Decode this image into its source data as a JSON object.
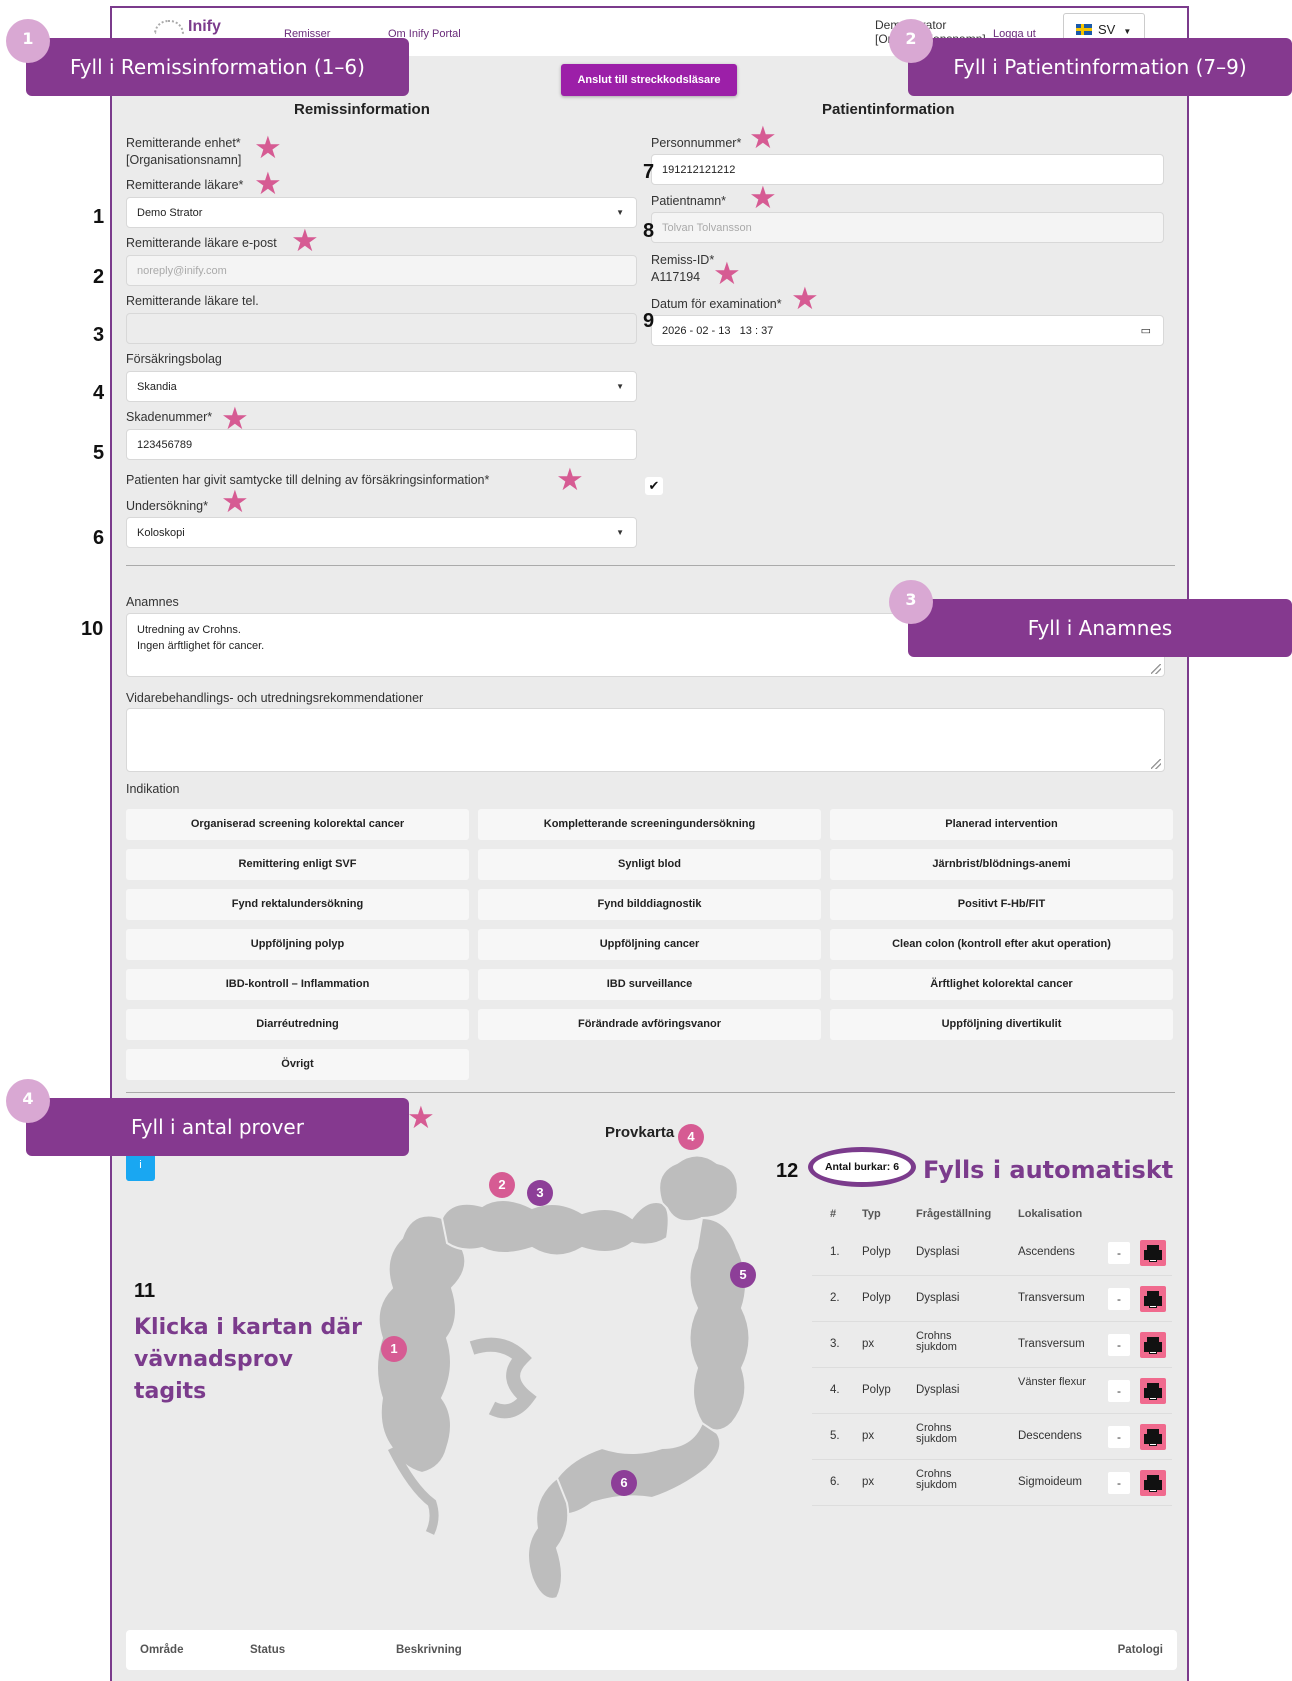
{
  "header": {
    "logo": "Inify",
    "nav": [
      "Remisser",
      "Om Inify Portal"
    ],
    "user_name": "Demo Strator",
    "user_org": "[Organisationsnamn]",
    "logout": "Logga ut",
    "language": "SV",
    "scan_button": "Anslut till streckkodsläsare"
  },
  "callouts": [
    {
      "n": "1",
      "text": "Fyll i Remissinformation (1–6)"
    },
    {
      "n": "2",
      "text": "Fyll i Patientinformation (7–9)"
    },
    {
      "n": "3",
      "text": "Fyll i Anamnes"
    },
    {
      "n": "4",
      "text": "Fyll i antal prover"
    }
  ],
  "remiss": {
    "title": "Remissinformation",
    "unit_label": "Remitterande enhet*",
    "unit_value": "[Organisationsnamn]",
    "doctor_label": "Remitterande läkare*",
    "doctor_value": "Demo Strator",
    "email_label": "Remitterande läkare e-post",
    "email_placeholder": "noreply@inify.com",
    "phone_label": "Remitterande läkare tel.",
    "phone_value": "",
    "insurer_label": "Försäkringsbolag",
    "insurer_value": "Skandia",
    "claim_label": "Skadenummer*",
    "claim_value": "123456789",
    "consent_label": "Patienten har givit samtycke till delning av försäkringsinformation*",
    "consent_checked": true,
    "exam_label": "Undersökning*",
    "exam_value": "Koloskopi"
  },
  "patient": {
    "title": "Patientinformation",
    "pnr_label": "Personnummer*",
    "pnr_value": "191212121212",
    "name_label": "Patientnamn*",
    "name_value": "Tolvan Tolvansson",
    "remiss_id_label": "Remiss-ID*",
    "remiss_id_value": "A117194",
    "date_label": "Datum för examination*",
    "date_value": "2026 - 02 - 13   13 : 37"
  },
  "anamnes": {
    "label": "Anamnes",
    "value": "Utredning av Crohns.\nIngen ärftlighet för cancer.",
    "rec_label": "Vidarebehandlings- och utredningsrekommendationer",
    "rec_value": ""
  },
  "indikation": {
    "label": "Indikation",
    "items": [
      "Organiserad screening kolorektal cancer",
      "Kompletterande screeningundersökning",
      "Planerad intervention",
      "Remittering enligt SVF",
      "Synligt blod",
      "Järnbrist/blödnings-anemi",
      "Fynd rektalundersökning",
      "Fynd bilddiagnostik",
      "Positivt F-Hb/FIT",
      "Uppföljning polyp",
      "Uppföljning cancer",
      "Clean colon (kontroll efter akut operation)",
      "IBD-kontroll – Inflammation",
      "IBD surveillance",
      "Ärftlighet kolorektal cancer",
      "Diarréutredning",
      "Förändrade avföringsvanor",
      "Uppföljning divertikulit",
      "Övrigt"
    ]
  },
  "provkarta": {
    "title": "Provkarta",
    "info_button": "i",
    "annotation_11": "11",
    "click_hint": "Klicka i kartan där vävnadsprov tagits",
    "annotation_12": "12",
    "antal": "Antal burkar: 6",
    "auto_text": "Fylls i automatiskt",
    "markers": [
      "1",
      "2",
      "3",
      "4",
      "5",
      "6"
    ],
    "columns": [
      "#",
      "Typ",
      "Frågeställning",
      "Lokalisation"
    ],
    "rows": [
      {
        "n": "1.",
        "typ": "Polyp",
        "fraga": "Dysplasi",
        "lok": "Ascendens"
      },
      {
        "n": "2.",
        "typ": "Polyp",
        "fraga": "Dysplasi",
        "lok": "Transversum"
      },
      {
        "n": "3.",
        "typ": "px",
        "fraga": "Crohns sjukdom",
        "lok": "Transversum"
      },
      {
        "n": "4.",
        "typ": "Polyp",
        "fraga": "Dysplasi",
        "lok": "Vänster flexur"
      },
      {
        "n": "5.",
        "typ": "px",
        "fraga": "Crohns sjukdom",
        "lok": "Descendens"
      },
      {
        "n": "6.",
        "typ": "px",
        "fraga": "Crohns sjukdom",
        "lok": "Sigmoideum"
      }
    ],
    "minus": "-"
  },
  "bottom_table": {
    "columns": [
      "Område",
      "Status",
      "Beskrivning",
      "Patologi"
    ]
  },
  "field_numbers": [
    "1",
    "2",
    "3",
    "4",
    "5",
    "6",
    "7",
    "8",
    "9",
    "10"
  ],
  "colors": {
    "accent": "#85398f",
    "star": "#d65b93",
    "button": "#9c1fa8",
    "info": "#19a7f2"
  }
}
